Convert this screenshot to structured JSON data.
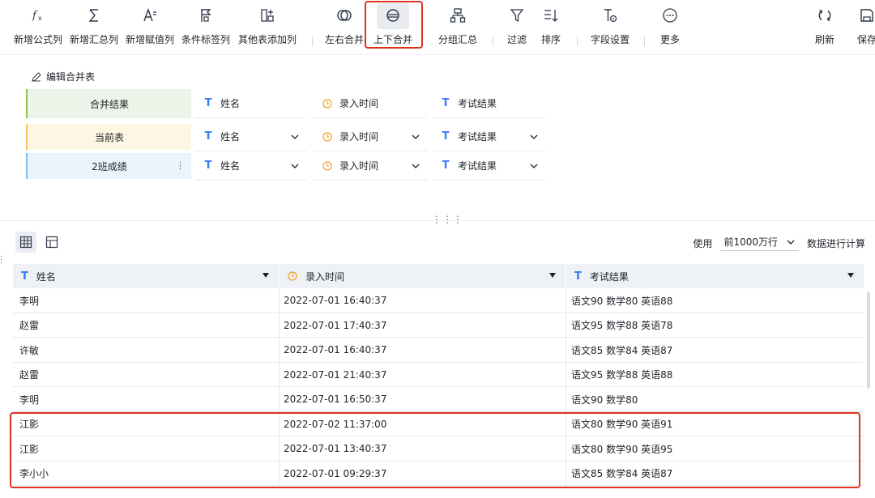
{
  "toolbar": {
    "items": [
      {
        "label": "新增公式列",
        "icon": "formula-icon"
      },
      {
        "label": "新增汇总列",
        "icon": "sigma-icon"
      },
      {
        "label": "新增赋值列",
        "icon": "assign-icon"
      },
      {
        "label": "条件标签列",
        "icon": "flag-icon"
      },
      {
        "label": "其他表添加列",
        "icon": "add-column-icon"
      },
      {
        "label": "左右合并",
        "icon": "venn-icon"
      },
      {
        "label": "上下合并",
        "icon": "stack-merge-icon"
      },
      {
        "label": "分组汇总",
        "icon": "group-icon"
      },
      {
        "label": "过滤",
        "icon": "filter-icon"
      },
      {
        "label": "排序",
        "icon": "sort-icon"
      },
      {
        "label": "字段设置",
        "icon": "field-settings-icon"
      },
      {
        "label": "更多",
        "icon": "more-icon"
      },
      {
        "label": "刷新",
        "icon": "refresh-icon"
      },
      {
        "label": "保存",
        "icon": "save-icon"
      }
    ]
  },
  "editor": {
    "title": "编辑合并表",
    "rows": [
      {
        "source": "合并结果",
        "fields": [
          "姓名",
          "录入时间",
          "考试结果"
        ]
      },
      {
        "source": "当前表",
        "fields": [
          "姓名",
          "录入时间",
          "考试结果"
        ]
      },
      {
        "source": "2班成绩",
        "fields": [
          "姓名",
          "录入时间",
          "考试结果"
        ]
      }
    ]
  },
  "usage": {
    "prefix": "使用",
    "selected": "前1000万行",
    "suffix": "数据进行计算"
  },
  "table": {
    "columns": [
      "姓名",
      "录入时间",
      "考试结果"
    ],
    "rows": [
      [
        "李明",
        "2022-07-01 16:40:37",
        "语文90 数学80 英语88"
      ],
      [
        "赵雷",
        "2022-07-01 17:40:37",
        "语文95 数学88 英语78"
      ],
      [
        "许敏",
        "2022-07-01 16:40:37",
        "语文85 数学84 英语87"
      ],
      [
        "赵雷",
        "2022-07-01 21:40:37",
        "语文95 数学88 英语88"
      ],
      [
        "李明",
        "2022-07-01 16:50:37",
        "语文90 数学80"
      ],
      [
        "江影",
        "2022-07-02 11:37:00",
        "语文80 数学90 英语91"
      ],
      [
        "江影",
        "2022-07-01 13:40:37",
        "语文80 数学90 英语95"
      ],
      [
        "李小小",
        "2022-07-01 09:29:37",
        "语文85 数学84 英语87"
      ]
    ]
  },
  "colors": {
    "accent_red": "#e0301e",
    "type_text": "#3a7afe",
    "type_time": "#f0a020",
    "result_row": "#eef3e9",
    "current_row": "#fdf6e3",
    "class2_row": "#eaf4fb"
  }
}
